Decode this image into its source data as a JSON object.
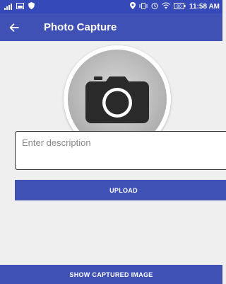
{
  "colors": {
    "primary": "#3f51b5",
    "status_bar": "#3649b8",
    "background": "#efefef"
  },
  "status_bar": {
    "left_icons": [
      "signal-icon",
      "screenshot-icon",
      "shield-icon"
    ],
    "right_icons": [
      "location-icon",
      "vibrate-icon",
      "alarm-icon",
      "wifi-icon",
      "battery-icon"
    ],
    "battery_level": "80",
    "time": "11:58 AM"
  },
  "app_bar": {
    "back_icon": "arrow-back-icon",
    "title": "Photo Capture"
  },
  "camera": {
    "icon": "camera-icon"
  },
  "description": {
    "placeholder": "Enter description",
    "value": ""
  },
  "upload_button": {
    "label": "UPLOAD"
  },
  "show_captured_button": {
    "label": "SHOW CAPTURED IMAGE"
  }
}
